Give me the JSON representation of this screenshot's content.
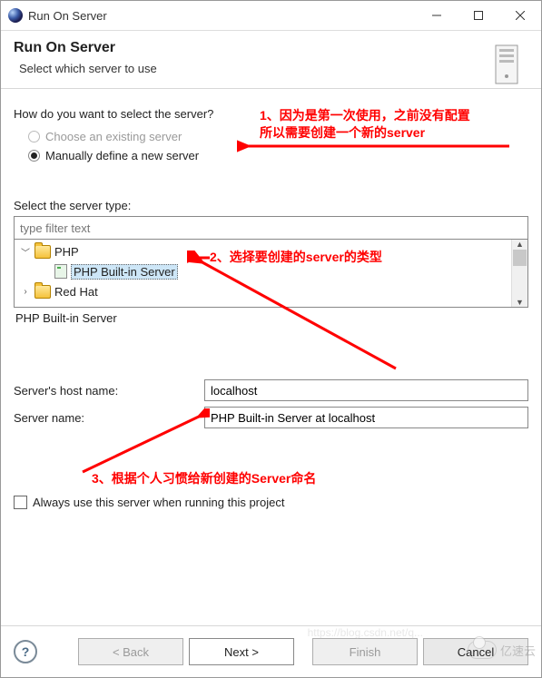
{
  "titlebar": {
    "title": "Run On Server"
  },
  "banner": {
    "heading": "Run On Server",
    "subtitle": "Select which server to use"
  },
  "question": "How do you want to select the server?",
  "radios": {
    "existing": "Choose an existing server",
    "manual": "Manually define a new server"
  },
  "tree": {
    "section_label": "Select the server type:",
    "filter_placeholder": "type filter text",
    "php_folder": "PHP",
    "php_builtin": "PHP Built-in Server",
    "redhat_folder": "Red Hat",
    "selected_type": "PHP Built-in Server"
  },
  "form": {
    "host_label": "Server's host name:",
    "host_value": "localhost",
    "name_label": "Server name:",
    "name_value": "PHP Built-in Server at localhost"
  },
  "always_checkbox": "Always use this server when running this project",
  "buttons": {
    "back": "< Back",
    "next": "Next >",
    "finish": "Finish",
    "cancel": "Cancel"
  },
  "annotations": {
    "a1_l1": "1、因为是第一次使用，之前没有配置",
    "a1_l2": "所以需要创建一个新的server",
    "a2": "2、选择要创建的server的类型",
    "a3": "3、根据个人习惯给新创建的Server命名"
  },
  "watermark": {
    "brand": "亿速云",
    "url": "https://blog.csdn.net/q..."
  }
}
